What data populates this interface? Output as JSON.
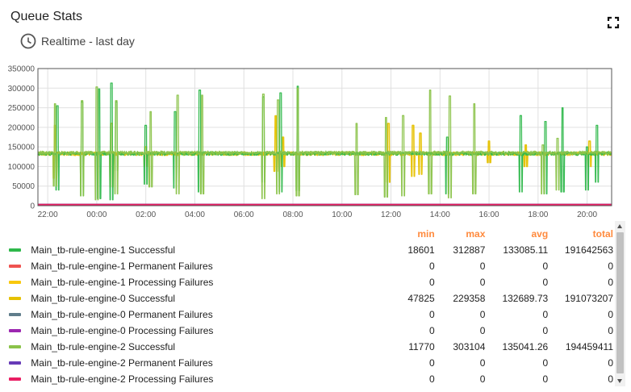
{
  "widget": {
    "title": "Queue Stats",
    "timewindow": "Realtime - last day",
    "icons": {
      "timewindow": "clock-icon",
      "fullscreen": "fullscreen-icon"
    }
  },
  "chart_data": {
    "type": "line",
    "ylim": [
      0,
      350000
    ],
    "yticks": [
      "350000",
      "300000",
      "250000",
      "200000",
      "150000",
      "100000",
      "50000",
      "0"
    ],
    "xticks": [
      "22:00",
      "00:00",
      "02:00",
      "04:00",
      "06:00",
      "08:00",
      "10:00",
      "12:00",
      "14:00",
      "16:00",
      "18:00",
      "20:00"
    ],
    "xrange_hours": [
      21.6,
      45.0
    ],
    "grid": true,
    "series": [
      {
        "name": "Main_tb-rule-engine-1 Successful",
        "color": "#2eb84b",
        "baseline": 133000,
        "spikes": [
          [
            22.4,
            40000,
            255000
          ],
          [
            23.4,
            25000,
            265000
          ],
          [
            24.1,
            18000,
            298000
          ],
          [
            24.6,
            15000,
            312887
          ],
          [
            24.8,
            90000,
            265000
          ],
          [
            26.0,
            55000,
            205000
          ],
          [
            27.2,
            45000,
            240000
          ],
          [
            28.2,
            35000,
            295000
          ],
          [
            30.8,
            60000,
            278000
          ],
          [
            31.5,
            35000,
            288000
          ],
          [
            32.2,
            38000,
            305000
          ],
          [
            38.3,
            30000,
            175000
          ],
          [
            41.3,
            35000,
            230000
          ],
          [
            42.3,
            30000,
            215000
          ],
          [
            43.0,
            35000,
            250000
          ],
          [
            44.0,
            40000,
            150000
          ],
          [
            44.4,
            60000,
            205000
          ]
        ]
      },
      {
        "name": "Main_tb-rule-engine-1 Permanent Failures",
        "color": "#ef5350",
        "flat": 0
      },
      {
        "name": "Main_tb-rule-engine-1 Processing Failures",
        "color": "#f9c80e",
        "flat": 0
      },
      {
        "name": "Main_tb-rule-engine-0 Successful",
        "color": "#e6c100",
        "baseline": 132700,
        "spikes": [
          [
            22.3,
            70000,
            205000
          ],
          [
            24.6,
            47825,
            210000
          ],
          [
            26.0,
            100000,
            150000
          ],
          [
            31.3,
            88000,
            229358
          ],
          [
            31.6,
            100000,
            175000
          ],
          [
            35.9,
            60000,
            210000
          ],
          [
            36.9,
            75000,
            205000
          ],
          [
            37.2,
            80000,
            185000
          ],
          [
            40.0,
            110000,
            165000
          ],
          [
            41.5,
            100000,
            155000
          ],
          [
            44.1,
            100000,
            165000
          ]
        ]
      },
      {
        "name": "Main_tb-rule-engine-0 Permanent Failures",
        "color": "#607d8b",
        "flat": 0
      },
      {
        "name": "Main_tb-rule-engine-0 Processing Failures",
        "color": "#9c27b0",
        "flat": 0
      },
      {
        "name": "Main_tb-rule-engine-2 Successful",
        "color": "#8bc34a",
        "baseline": 135000,
        "spikes": [
          [
            22.3,
            50000,
            260000
          ],
          [
            23.4,
            25000,
            268000
          ],
          [
            24.0,
            15000,
            303104
          ],
          [
            24.8,
            30000,
            268000
          ],
          [
            26.2,
            48000,
            240000
          ],
          [
            27.3,
            30000,
            282000
          ],
          [
            28.3,
            30000,
            282000
          ],
          [
            30.8,
            18000,
            285000
          ],
          [
            31.4,
            30000,
            270000
          ],
          [
            32.2,
            25000,
            300000
          ],
          [
            34.6,
            28000,
            210000
          ],
          [
            35.8,
            22000,
            225000
          ],
          [
            36.5,
            25000,
            230000
          ],
          [
            37.6,
            30000,
            295000
          ],
          [
            38.4,
            20000,
            280000
          ],
          [
            39.4,
            30000,
            260000
          ],
          [
            42.2,
            30000,
            155000
          ],
          [
            42.8,
            40000,
            172000
          ]
        ]
      },
      {
        "name": "Main_tb-rule-engine-2 Permanent Failures",
        "color": "#3f51b5",
        "flat": 0
      },
      {
        "name": "Main_tb-rule-engine-2 Processing Failures",
        "color": "#e91e63",
        "flat": 0
      }
    ]
  },
  "legend": {
    "headers": {
      "min": "min",
      "max": "max",
      "avg": "avg",
      "total": "total"
    },
    "rows": [
      {
        "label": "Main_tb-rule-engine-1 Successful",
        "color": "#2eb84b",
        "min": "18601",
        "max": "312887",
        "avg": "133085.11",
        "total": "191642563"
      },
      {
        "label": "Main_tb-rule-engine-1 Permanent Failures",
        "color": "#ef5350",
        "min": "0",
        "max": "0",
        "avg": "0",
        "total": "0"
      },
      {
        "label": "Main_tb-rule-engine-1 Processing Failures",
        "color": "#f9c80e",
        "min": "0",
        "max": "0",
        "avg": "0",
        "total": "0"
      },
      {
        "label": "Main_tb-rule-engine-0 Successful",
        "color": "#e6c100",
        "min": "47825",
        "max": "229358",
        "avg": "132689.73",
        "total": "191073207"
      },
      {
        "label": "Main_tb-rule-engine-0 Permanent Failures",
        "color": "#607d8b",
        "min": "0",
        "max": "0",
        "avg": "0",
        "total": "0"
      },
      {
        "label": "Main_tb-rule-engine-0 Processing Failures",
        "color": "#9c27b0",
        "min": "0",
        "max": "0",
        "avg": "0",
        "total": "0"
      },
      {
        "label": "Main_tb-rule-engine-2 Successful",
        "color": "#8bc34a",
        "min": "11770",
        "max": "303104",
        "avg": "135041.26",
        "total": "194459411"
      },
      {
        "label": "Main_tb-rule-engine-2 Permanent Failures",
        "color": "#673ab7",
        "min": "0",
        "max": "0",
        "avg": "0",
        "total": "0"
      },
      {
        "label": "Main_tb-rule-engine-2 Processing Failures",
        "color": "#e91e63",
        "min": "0",
        "max": "0",
        "avg": "0",
        "total": "0"
      }
    ]
  }
}
